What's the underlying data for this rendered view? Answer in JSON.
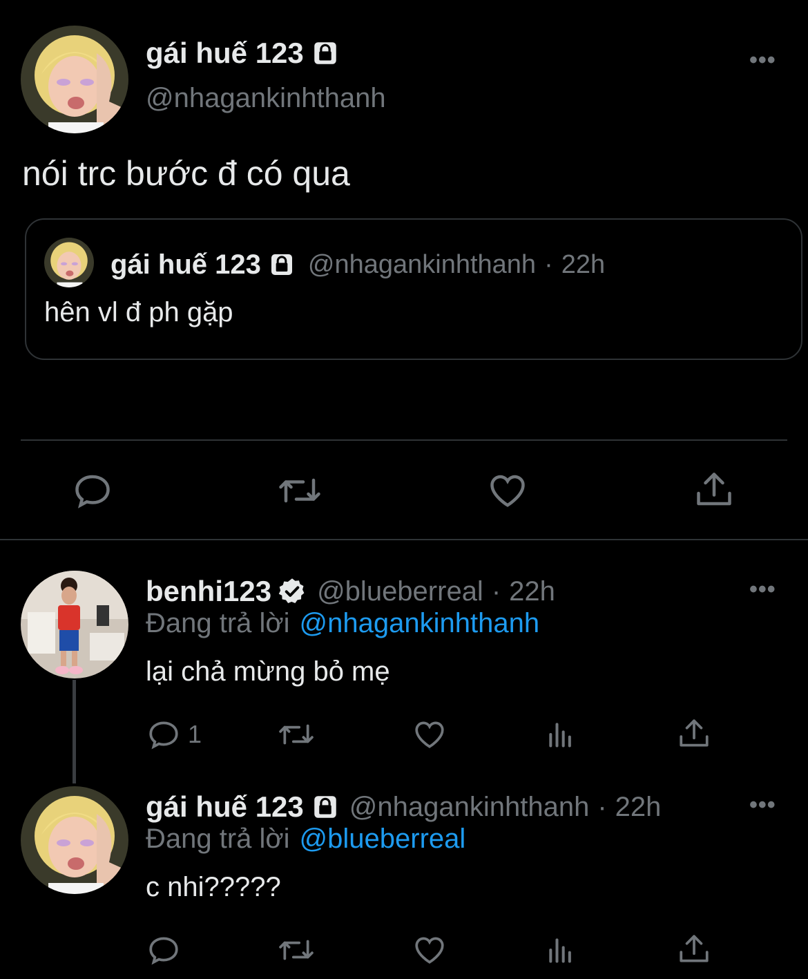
{
  "main_tweet": {
    "display_name": "gái huế 123",
    "handle": "@nhagankinhthanh",
    "text": "nói trc bước đ có qua",
    "quote": {
      "display_name": "gái huế 123",
      "handle": "@nhagankinhthanh",
      "separator": "·",
      "time": "22h",
      "text": "hên vl đ ph gặp"
    },
    "icons": [
      "avatar",
      "lock-icon",
      "more-icon",
      "reply-icon",
      "retweet-icon",
      "like-icon",
      "share-icon"
    ]
  },
  "reply1": {
    "display_name": "benhi123",
    "handle": "@blueberreal",
    "separator": "·",
    "time": "22h",
    "replying_prefix": "Đang trả lời",
    "replying_to": "@nhagankinhthanh",
    "text": "lại chả mừng bỏ mẹ",
    "reply_count": "1",
    "icons": [
      "verified-badge-icon",
      "analytics-icon"
    ]
  },
  "reply2": {
    "display_name": "gái huế 123",
    "handle": "@nhagankinhthanh",
    "separator": "·",
    "time": "22h",
    "replying_prefix": "Đang trả lời",
    "replying_to": "@blueberreal",
    "text": "c nhi?????"
  },
  "colors": {
    "background": "#000000",
    "text": "#e7e9ea",
    "secondary": "#71767b",
    "link": "#1d9bf0",
    "divider": "#2f3336"
  }
}
